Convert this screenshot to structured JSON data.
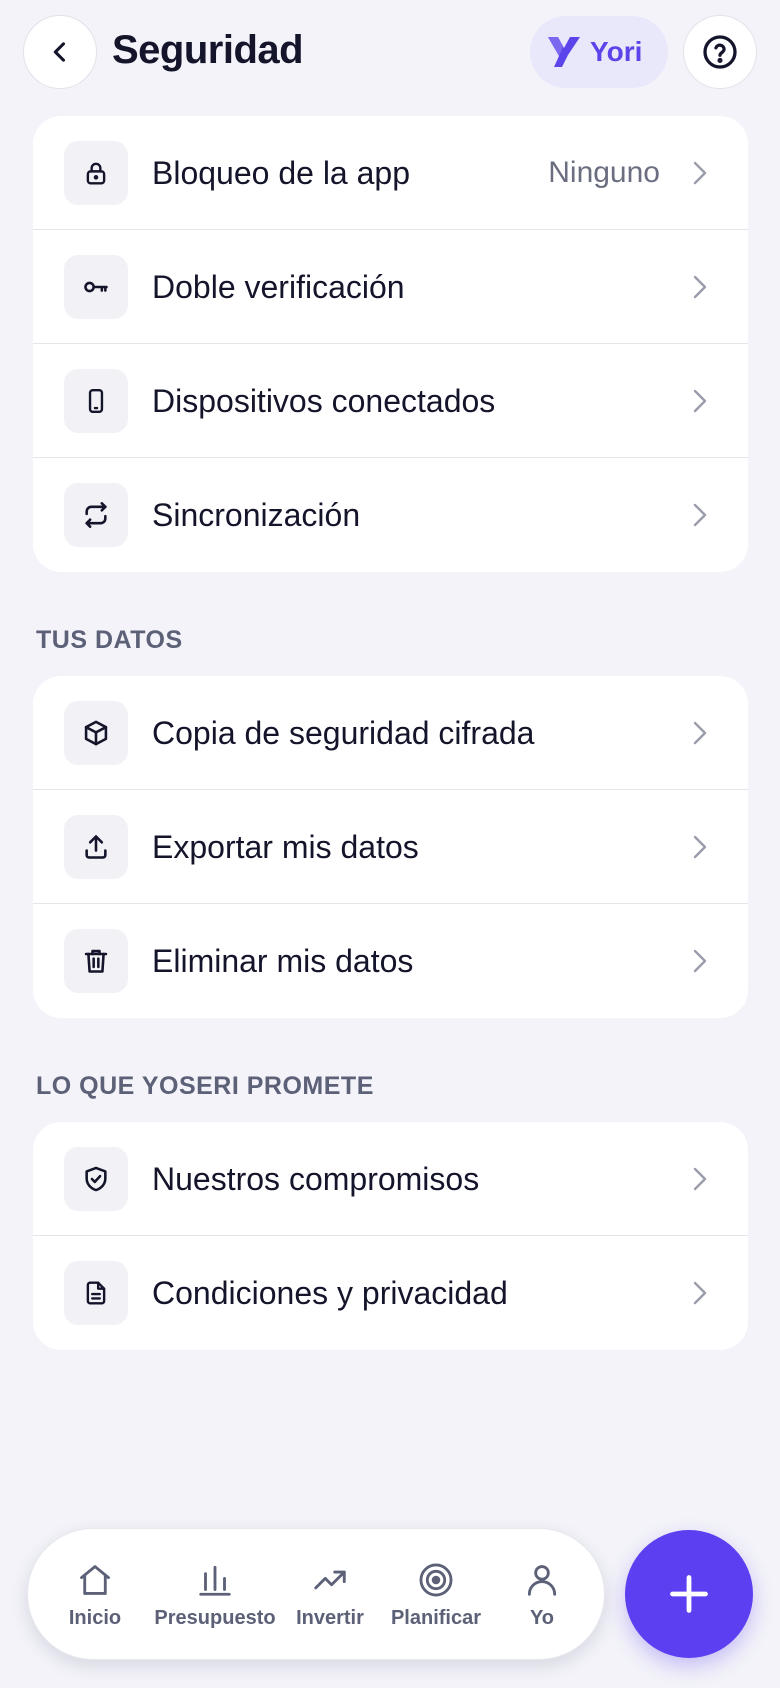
{
  "header": {
    "title": "Seguridad",
    "assistant_name": "Yori"
  },
  "security_items": [
    {
      "label": "Bloqueo de la app",
      "value": "Ninguno"
    },
    {
      "label": "Doble verificación"
    },
    {
      "label": "Dispositivos conectados"
    },
    {
      "label": "Sincronización"
    }
  ],
  "data_section": {
    "title": "TUS DATOS",
    "items": [
      {
        "label": "Copia de seguridad cifrada"
      },
      {
        "label": "Exportar mis datos"
      },
      {
        "label": "Eliminar mis datos"
      }
    ]
  },
  "promise_section": {
    "title": "LO QUE YOSERI PROMETE",
    "items": [
      {
        "label": "Nuestros compromisos"
      },
      {
        "label": "Condiciones y privacidad"
      }
    ]
  },
  "bottom_nav": {
    "items": [
      {
        "label": "Inicio",
        "icon": "home-icon"
      },
      {
        "label": "Presupuesto",
        "icon": "bar-chart-icon"
      },
      {
        "label": "Invertir",
        "icon": "trend-up-icon"
      },
      {
        "label": "Planificar",
        "icon": "target-icon"
      },
      {
        "label": "Yo",
        "icon": "user-icon"
      }
    ]
  },
  "colors": {
    "accent": "#5b3ff0",
    "background": "#f3f3f9",
    "pill_bg": "#e9e8fb"
  }
}
